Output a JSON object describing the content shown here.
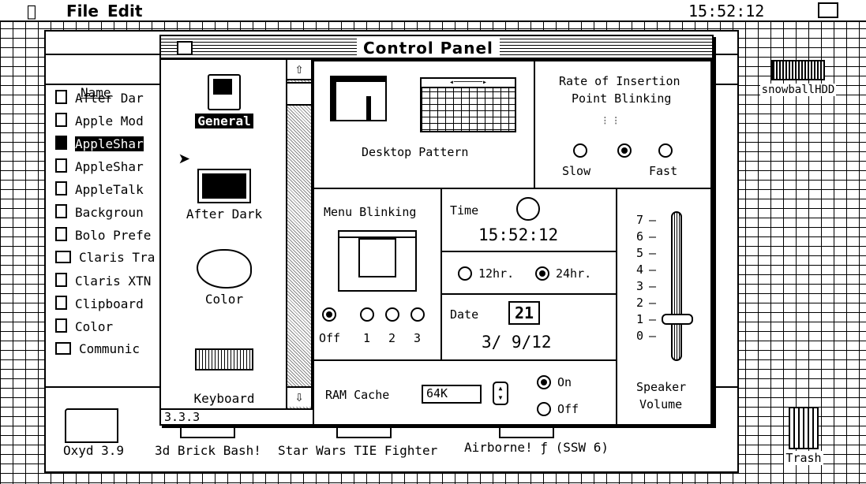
{
  "menubar": {
    "apple": "",
    "file": "File",
    "edit": "Edit",
    "clock": "15:52:12"
  },
  "finder": {
    "name_header": "Name",
    "items": [
      {
        "label": "After Dar",
        "icon": "document-icon"
      },
      {
        "label": "Apple Mod",
        "icon": "document-icon"
      },
      {
        "label": "AppleShar",
        "icon": "document-icon",
        "selected": true
      },
      {
        "label": "AppleShar",
        "icon": "document-icon"
      },
      {
        "label": "AppleTalk",
        "icon": "document-icon"
      },
      {
        "label": "Backgroun",
        "icon": "document-icon"
      },
      {
        "label": "Bolo Prefe",
        "icon": "document-icon"
      },
      {
        "label": "Claris Tra",
        "icon": "folder-icon"
      },
      {
        "label": "Claris XTN",
        "icon": "document-icon"
      },
      {
        "label": "Clipboard",
        "icon": "document-icon"
      },
      {
        "label": "Color",
        "icon": "document-icon"
      },
      {
        "label": "Communic",
        "icon": "folder-icon"
      }
    ],
    "bottom_items": [
      "Oxyd 3.9",
      "3d Brick Bash!",
      "Star Wars TIE Fighter",
      "Airborne! ƒ (SSW 6)"
    ]
  },
  "desktop": {
    "hdd_label": "snowballHDD",
    "trash_label": "Trash"
  },
  "control_panel": {
    "title": "Control Panel",
    "version": "3.3.3",
    "cdevs": [
      {
        "label": "General",
        "selected": true
      },
      {
        "label": "After Dark"
      },
      {
        "label": "Color"
      },
      {
        "label": "Keyboard"
      }
    ],
    "desktop_pattern_label": "Desktop Pattern",
    "blink": {
      "title_line1": "Rate of Insertion",
      "title_line2": "Point Blinking",
      "slow": "Slow",
      "fast": "Fast",
      "selected": "middle"
    },
    "menu_blinking": {
      "title": "Menu Blinking",
      "options": [
        "Off",
        "1",
        "2",
        "3"
      ],
      "selected": "Off"
    },
    "time": {
      "label": "Time",
      "value": "15:52:12",
      "fmt12": "12hr.",
      "fmt24": "24hr.",
      "selected_format": "24hr."
    },
    "date": {
      "label": "Date",
      "value": "3/ 9/12",
      "icon_digits": "21"
    },
    "speaker": {
      "label_line1": "Speaker",
      "label_line2": "Volume",
      "ticks": [
        "7",
        "6",
        "5",
        "4",
        "3",
        "2",
        "1",
        "0"
      ],
      "level": 1
    },
    "ram_cache": {
      "label": "RAM Cache",
      "value": "64K",
      "on": "On",
      "off": "Off",
      "selected": "On"
    }
  }
}
